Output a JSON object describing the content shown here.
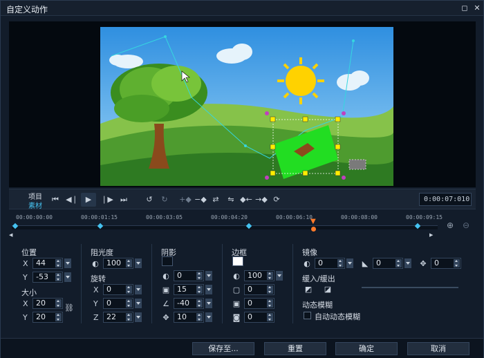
{
  "window": {
    "title": "自定义动作"
  },
  "titlebar": {
    "maximize_icon": "maximize-icon",
    "close_icon": "close-icon"
  },
  "transport": {
    "project_label": "项目",
    "clip_label": "素材",
    "timecode": "0:00:07:010",
    "buttons": [
      "skip-start-icon",
      "step-back-icon",
      "play-icon",
      "step-forward-icon",
      "skip-end-icon",
      "undo-icon",
      "redo-icon",
      "add-keyframe-icon",
      "remove-keyframe-icon",
      "reverse-icon",
      "swap-icon",
      "prev-keyframe-icon",
      "next-keyframe-icon",
      "convert-icon"
    ]
  },
  "timeline": {
    "ticks": [
      "00:00:00:00",
      "00:00:01:15",
      "00:00:03:05",
      "00:00:04:20",
      "00:00:06:10",
      "00:00:08:00",
      "00:00:09:15"
    ]
  },
  "position": {
    "label": "位置",
    "x_axis": "X",
    "y_axis": "Y",
    "x": "44",
    "y": "-53"
  },
  "size": {
    "label": "大小",
    "x_axis": "X",
    "y_axis": "Y",
    "x": "20",
    "y": "20"
  },
  "opacity": {
    "label": "阻光度",
    "value": "100"
  },
  "rotation": {
    "label": "旋转",
    "x_axis": "X",
    "y_axis": "Y",
    "z_axis": "Z",
    "x": "0",
    "y": "0",
    "z": "22"
  },
  "shadow": {
    "label": "阴影",
    "color": "#0a121c",
    "opacity": "0",
    "blur": "15",
    "angle": "-40",
    "distance": "10"
  },
  "border": {
    "label": "边框",
    "color": "#ffffff",
    "opacity": "100",
    "width": "0",
    "blur": "0",
    "inner": "0"
  },
  "mirror": {
    "label": "镜像",
    "opacity": "0",
    "fade": "0",
    "offset": "0"
  },
  "ease": {
    "label": "缓入/缓出"
  },
  "motion_blur": {
    "label": "动态模糊",
    "auto_label": "自动动态模糊",
    "auto_checked": false
  },
  "footer": {
    "save_to": "保存至...",
    "reset": "重置",
    "ok": "确定",
    "cancel": "取消"
  },
  "colors": {
    "accent": "#45c2f0",
    "keyframe": "#45c2f0",
    "playhead": "#ff7a2a",
    "selection": "#22dd22"
  }
}
